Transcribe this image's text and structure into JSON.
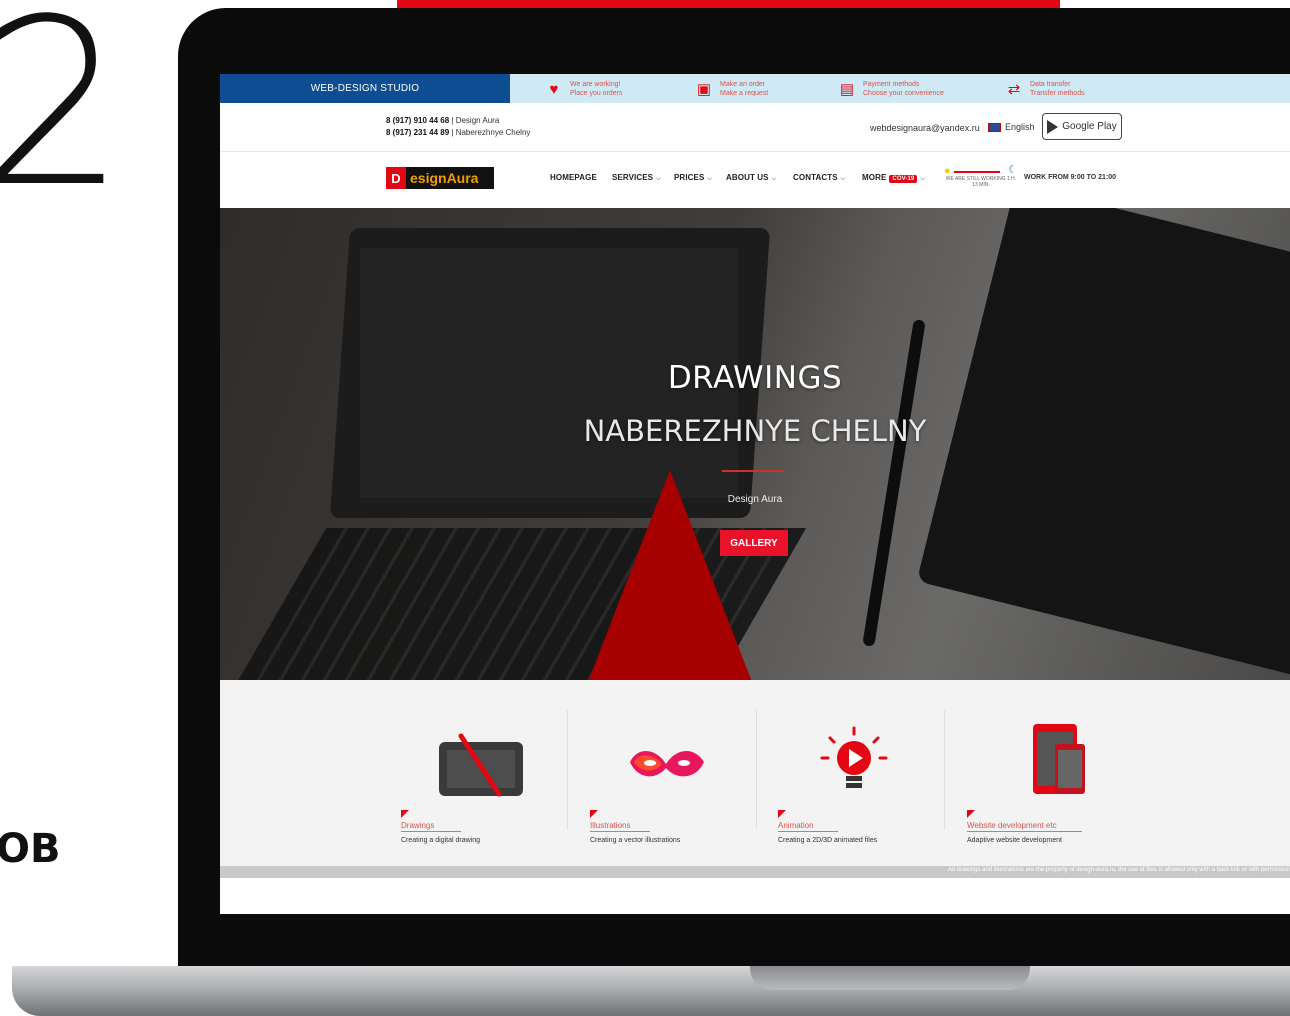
{
  "decor": {
    "big_number": "2",
    "side_letters": "ОВ"
  },
  "topbar": {
    "studio": "WEB-DESIGN STUDIO",
    "items": [
      {
        "icon": "handshake-icon",
        "line1": "We are working!",
        "line2": "Place you orders"
      },
      {
        "icon": "cart-icon",
        "line1": "Make an order",
        "line2": "Make a request"
      },
      {
        "icon": "wallet-icon",
        "line1": "Payment methods",
        "line2": "Choose your convenience"
      },
      {
        "icon": "transfer-arrows-icon",
        "line1": "Data transfer",
        "line2": "Transfer methods"
      }
    ]
  },
  "contact": {
    "phone1": "8 (917) 910 44 68",
    "phone1_label": " | Design Aura",
    "phone2": "8 (917) 231 44 89",
    "phone2_label": " | Naberezhnye Chelny",
    "email": "webdesignaura@yandex.ru",
    "language": "English",
    "store": "Google Play"
  },
  "nav": {
    "logo_letter": "D",
    "logo_text": "esignAura",
    "items": [
      "HOMEPAGE",
      "SERVICES",
      "PRICES",
      "ABOUT US",
      "CONTACTS",
      "MORE"
    ],
    "more_badge": "COV-19",
    "status_text": "WE ARE STILL WORKING 1 H. 13 MIN.",
    "hours": "WORK FROM 9:00 TO 21:00"
  },
  "hero": {
    "title": "DRAWINGS",
    "subtitle": "NABEREZHNYE CHELNY",
    "caption": "Design Aura",
    "button": "GALLERY"
  },
  "services": [
    {
      "icon": "drawing-tablet-icon",
      "title": "Drawings",
      "desc": "Creating a digital drawing"
    },
    {
      "icon": "mask-icon",
      "title": "Illustrations",
      "desc": "Creating a vector illustrations"
    },
    {
      "icon": "lightbulb-play-icon",
      "title": "Animation",
      "desc": "Creating a 2D/3D animated files"
    },
    {
      "icon": "devices-icon",
      "title": "Website development etc",
      "desc": "Adaptive website development"
    }
  ],
  "footer": {
    "note": "All drawings and illustrations are the property of design-aura.ru, the use of files is allowed only with a back link or with permission"
  },
  "colors": {
    "accent": "#e30613",
    "studio_blue": "#0e4d92",
    "topbar_bg": "#cfe9f5"
  }
}
